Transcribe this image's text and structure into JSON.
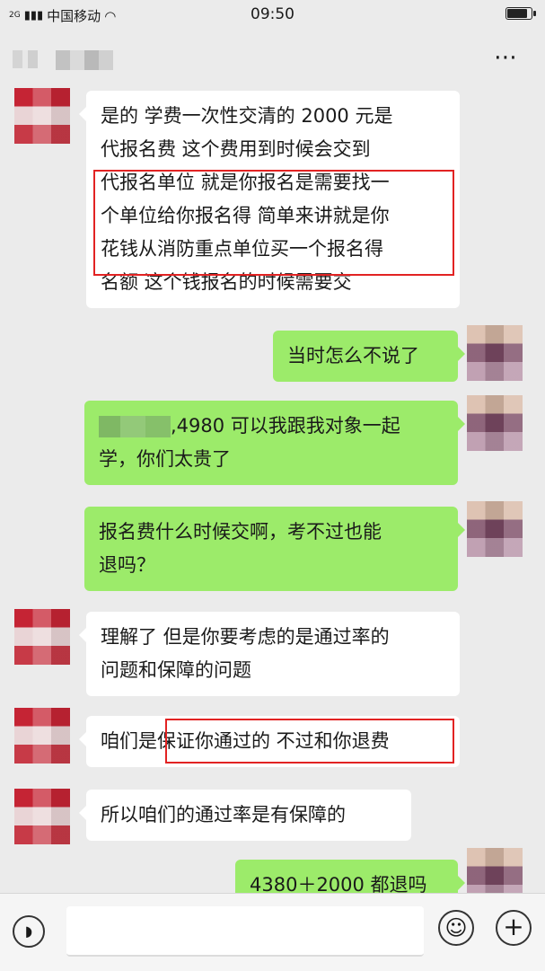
{
  "status_bar": {
    "signal_label": "2G",
    "carrier": "中国移动",
    "time": "09:50"
  },
  "header": {
    "more_icon": "⋯"
  },
  "messages": [
    {
      "side": "left",
      "lines": [
        "是的  学费一次性交清的  2000 元是",
        "代报名费  这个费用到时候会交到",
        "代报名单位  就是你报名是需要找一",
        "个单位给你报名得  简单来讲就是你",
        "花钱从消防重点单位买一个报名得",
        "名额  这个钱报名的时候需要交"
      ]
    },
    {
      "side": "right",
      "lines": [
        "当时怎么不说了"
      ]
    },
    {
      "side": "right",
      "name_redacted": true,
      "lines": [
        ",4980 可以我跟我对象一起",
        "学，你们太贵了"
      ]
    },
    {
      "side": "right",
      "lines": [
        "报名费什么时候交啊，考不过也能",
        "退吗？"
      ]
    },
    {
      "side": "left",
      "lines": [
        "理解了  但是你要考虑的是通过率的",
        "问题和保障的问题"
      ]
    },
    {
      "side": "left",
      "lines": [
        "咱们是保证你通过的  不过和你退费"
      ]
    },
    {
      "side": "left",
      "lines": [
        "所以咱们的通过率是有保障的"
      ]
    },
    {
      "side": "right",
      "lines": [
        "4380＋2000 都退吗"
      ]
    }
  ],
  "input_bar": {
    "voice_icon": "voice-icon",
    "emoji_icon": "emoji-icon",
    "plus_icon": "plus-icon"
  },
  "colors": {
    "background": "#ebebeb",
    "bubble_left": "#ffffff",
    "bubble_right": "#9ceb6a",
    "highlight_box": "#e22323"
  }
}
